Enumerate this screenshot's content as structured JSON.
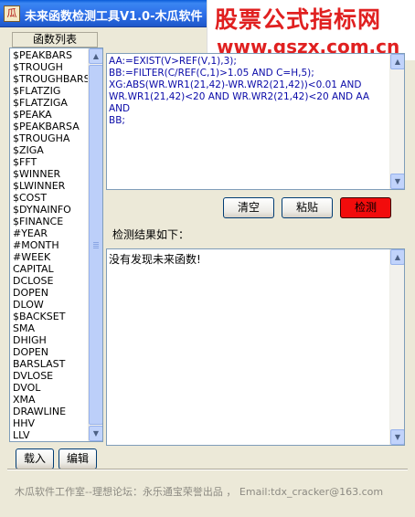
{
  "window": {
    "title": "未来函数检测工具V1.0-木瓜软件",
    "icon_glyph": "瓜"
  },
  "watermark": {
    "title": "股票公式指标网",
    "url": "www.gszx.com.cn"
  },
  "function_list": {
    "header": "函数列表",
    "items": [
      "$PEAKBARS",
      "$TROUGH",
      "$TROUGHBARS",
      "$FLATZIG",
      "$FLATZIGA",
      "$PEAKA",
      "$PEAKBARSA",
      "$TROUGHA",
      "$ZIGA",
      "$FFT",
      "$WINNER",
      "$LWINNER",
      "$COST",
      "$DYNAINFO",
      "$FINANCE",
      "#YEAR",
      "#MONTH",
      "#WEEK",
      "CAPITAL",
      "DCLOSE",
      "DOPEN",
      "DLOW",
      "$BACKSET",
      "SMA",
      "DHIGH",
      "DOPEN",
      "BARSLAST",
      "DVLOSE",
      "DVOL",
      "XMA",
      "DRAWLINE",
      "HHV",
      "LLV"
    ]
  },
  "buttons": {
    "load": "载入",
    "edit": "编辑",
    "clear": "清空",
    "paste": "粘贴",
    "check": "检测"
  },
  "editor": {
    "formula": "AA:=EXIST(V>REF(V,1),3);\nBB:=FILTER(C/REF(C,1)>1.05 AND C=H,5);\nXG:ABS(WR.WR1(21,42)-WR.WR2(21,42))<0.01 AND\nWR.WR1(21,42)<20 AND WR.WR2(21,42)<20 AND AA AND\nBB;"
  },
  "result": {
    "label": "检测结果如下：",
    "text": "没有发现未来函数!"
  },
  "footer": {
    "text": "木瓜软件工作室--理想论坛：永乐通宝荣誉出品 ， Email:tdx_cracker@163.com"
  },
  "colors": {
    "titlebar": "#2C6EE8",
    "watermark_red": "#E02020",
    "check_button": "#F20C0C",
    "formula_text": "#0A0AA8"
  }
}
